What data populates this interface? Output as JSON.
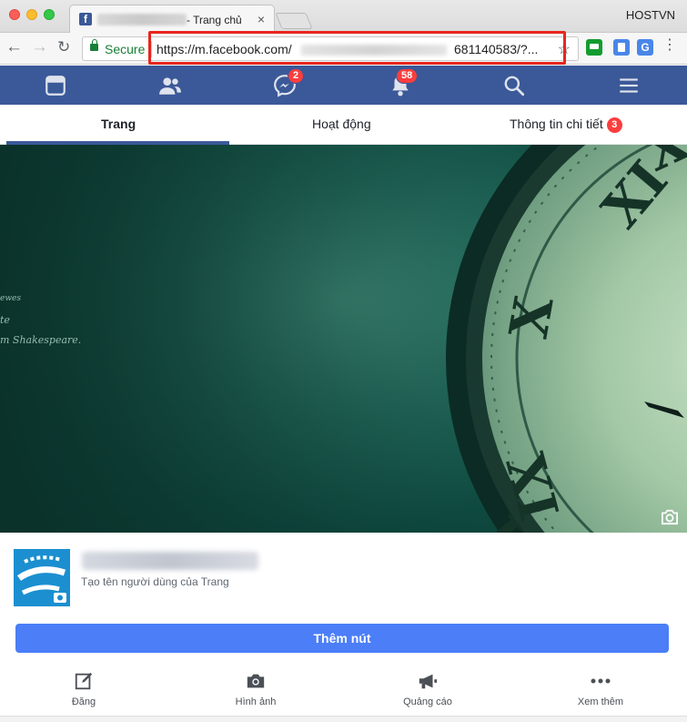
{
  "browser": {
    "tab_title": "- Trang chủ",
    "tab_favicon": "f",
    "profile_name": "HOSTVN",
    "secure_label": "Secure",
    "url_start": "https://m.facebook.com/",
    "url_end": "681140583/?...",
    "extensions": [
      "robot-extension-icon",
      "image-extension-icon",
      "google-translate-icon"
    ]
  },
  "fb_nav": {
    "messages_badge": "2",
    "notifications_badge": "58",
    "brand_color": "#3b5998"
  },
  "page_tabs": {
    "items": [
      {
        "label": "Trang"
      },
      {
        "label": "Hoạt động"
      },
      {
        "label": "Thông tin chi tiết",
        "badge": "3"
      }
    ]
  },
  "cover": {
    "quote_lines": [
      "ewes",
      "te",
      "m Shakespeare."
    ]
  },
  "profile": {
    "username_prompt": "Tạo tên người dùng của Trang"
  },
  "cta": {
    "label": "Thêm nút",
    "color": "#4b7ef7"
  },
  "actions": [
    {
      "label": "Đăng",
      "icon": "edit-icon"
    },
    {
      "label": "Hình ảnh",
      "icon": "camera-icon"
    },
    {
      "label": "Quảng cáo",
      "icon": "megaphone-icon"
    },
    {
      "label": "Xem thêm",
      "icon": "more-icon"
    }
  ]
}
